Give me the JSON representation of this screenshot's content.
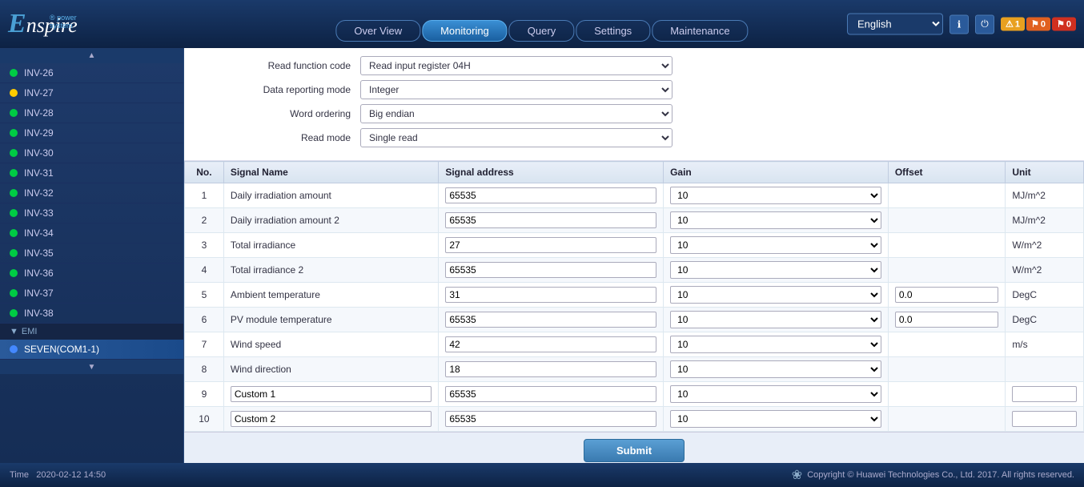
{
  "header": {
    "logo": "Enspire",
    "logo_sub": "® power system",
    "language_label": "English",
    "nav_tabs": [
      {
        "id": "overview",
        "label": "Over View",
        "active": false
      },
      {
        "id": "monitoring",
        "label": "Monitoring",
        "active": true
      },
      {
        "id": "query",
        "label": "Query",
        "active": false
      },
      {
        "id": "settings",
        "label": "Settings",
        "active": false
      },
      {
        "id": "maintenance",
        "label": "Maintenance",
        "active": false
      }
    ],
    "alerts": [
      {
        "type": "yellow",
        "icon": "⚠",
        "count": "1"
      },
      {
        "type": "orange",
        "icon": "⚑",
        "count": "0"
      },
      {
        "type": "red",
        "icon": "⚑",
        "count": "0"
      }
    ]
  },
  "sidebar": {
    "items": [
      {
        "id": "inv26",
        "label": "INV-26",
        "dot": "green",
        "active": false
      },
      {
        "id": "inv27",
        "label": "INV-27",
        "dot": "yellow",
        "active": false
      },
      {
        "id": "inv28",
        "label": "INV-28",
        "dot": "green",
        "active": false
      },
      {
        "id": "inv29",
        "label": "INV-29",
        "dot": "green",
        "active": false
      },
      {
        "id": "inv30",
        "label": "INV-30",
        "dot": "green",
        "active": false
      },
      {
        "id": "inv31",
        "label": "INV-31",
        "dot": "green",
        "active": false
      },
      {
        "id": "inv32",
        "label": "INV-32",
        "dot": "green",
        "active": false
      },
      {
        "id": "inv33",
        "label": "INV-33",
        "dot": "green",
        "active": false
      },
      {
        "id": "inv34",
        "label": "INV-34",
        "dot": "green",
        "active": false
      },
      {
        "id": "inv35",
        "label": "INV-35",
        "dot": "green",
        "active": false
      },
      {
        "id": "inv36",
        "label": "INV-36",
        "dot": "green",
        "active": false
      },
      {
        "id": "inv37",
        "label": "INV-37",
        "dot": "green",
        "active": false
      },
      {
        "id": "inv38",
        "label": "INV-38",
        "dot": "green",
        "active": false
      }
    ],
    "group_label": "EMI",
    "active_device": "SEVEN(COM1-1)"
  },
  "form": {
    "read_function_code_label": "Read function code",
    "read_function_code_value": "Read input register 04H",
    "data_reporting_mode_label": "Data reporting mode",
    "data_reporting_mode_value": "Integer",
    "word_ordering_label": "Word ordering",
    "word_ordering_value": "Big endian",
    "read_mode_label": "Read mode",
    "read_mode_value": "Single read"
  },
  "table": {
    "columns": [
      "No.",
      "Signal Name",
      "Signal address",
      "Gain",
      "Offset",
      "Unit"
    ],
    "rows": [
      {
        "no": "1",
        "name": "Daily irradiation amount",
        "addr": "65535",
        "gain": "10",
        "offset": "",
        "unit": "MJ/m^2",
        "name_editable": false
      },
      {
        "no": "2",
        "name": "Daily irradiation amount 2",
        "addr": "65535",
        "gain": "10",
        "offset": "",
        "unit": "MJ/m^2",
        "name_editable": false
      },
      {
        "no": "3",
        "name": "Total irradiance",
        "addr": "27",
        "gain": "10",
        "offset": "",
        "unit": "W/m^2",
        "name_editable": false
      },
      {
        "no": "4",
        "name": "Total irradiance 2",
        "addr": "65535",
        "gain": "10",
        "offset": "",
        "unit": "W/m^2",
        "name_editable": false
      },
      {
        "no": "5",
        "name": "Ambient temperature",
        "addr": "31",
        "gain": "10",
        "offset": "0.0",
        "unit": "DegC",
        "name_editable": false
      },
      {
        "no": "6",
        "name": "PV module temperature",
        "addr": "65535",
        "gain": "10",
        "offset": "0.0",
        "unit": "DegC",
        "name_editable": false
      },
      {
        "no": "7",
        "name": "Wind speed",
        "addr": "42",
        "gain": "10",
        "offset": "",
        "unit": "m/s",
        "name_editable": false
      },
      {
        "no": "8",
        "name": "Wind direction",
        "addr": "18",
        "gain": "10",
        "offset": "",
        "unit": "",
        "name_editable": false
      },
      {
        "no": "9",
        "name": "Custom 1",
        "addr": "65535",
        "gain": "10",
        "offset": "",
        "unit": "",
        "name_editable": true
      },
      {
        "no": "10",
        "name": "Custom 2",
        "addr": "65535",
        "gain": "10",
        "offset": "",
        "unit": "",
        "name_editable": true
      }
    ]
  },
  "submit_label": "Submit",
  "footer": {
    "time_label": "Time",
    "time_value": "2020-02-12 14:50",
    "copyright": "Copyright © Huawei Technologies Co., Ltd. 2017. All rights reserved."
  }
}
